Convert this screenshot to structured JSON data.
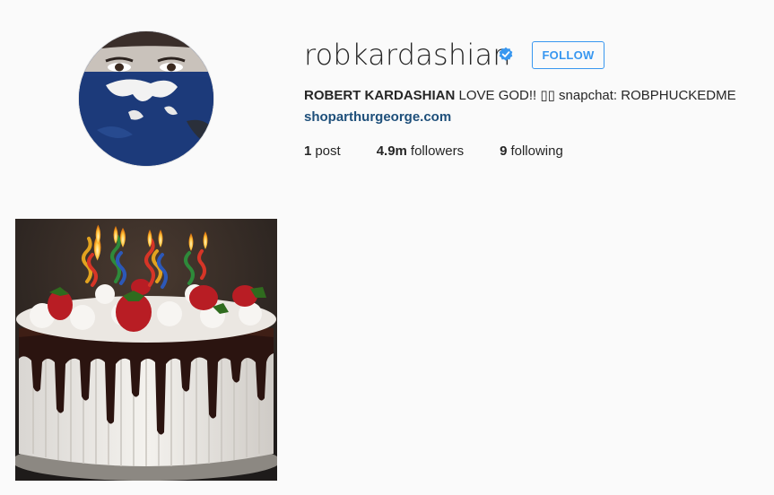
{
  "profile": {
    "username": "robkardashian",
    "verified": true,
    "follow_label": "FOLLOW",
    "full_name": "ROBERT KARDASHIAN",
    "bio_text": "LOVE GOD!! ▯▯ snapchat: ROBPHUCKEDME",
    "website": "shoparthurgeorge.com"
  },
  "stats": {
    "posts_count": "1",
    "posts_label": "post",
    "followers_count": "4.9m",
    "followers_label": "followers",
    "following_count": "9",
    "following_label": "following"
  },
  "posts": [
    {
      "subject": "birthday cake with lit candles"
    }
  ],
  "colors": {
    "page_bg": "#fafafa",
    "accent_blue": "#3897f0",
    "link_color": "#1e4f7a",
    "verified_badge": "#3897f0"
  }
}
